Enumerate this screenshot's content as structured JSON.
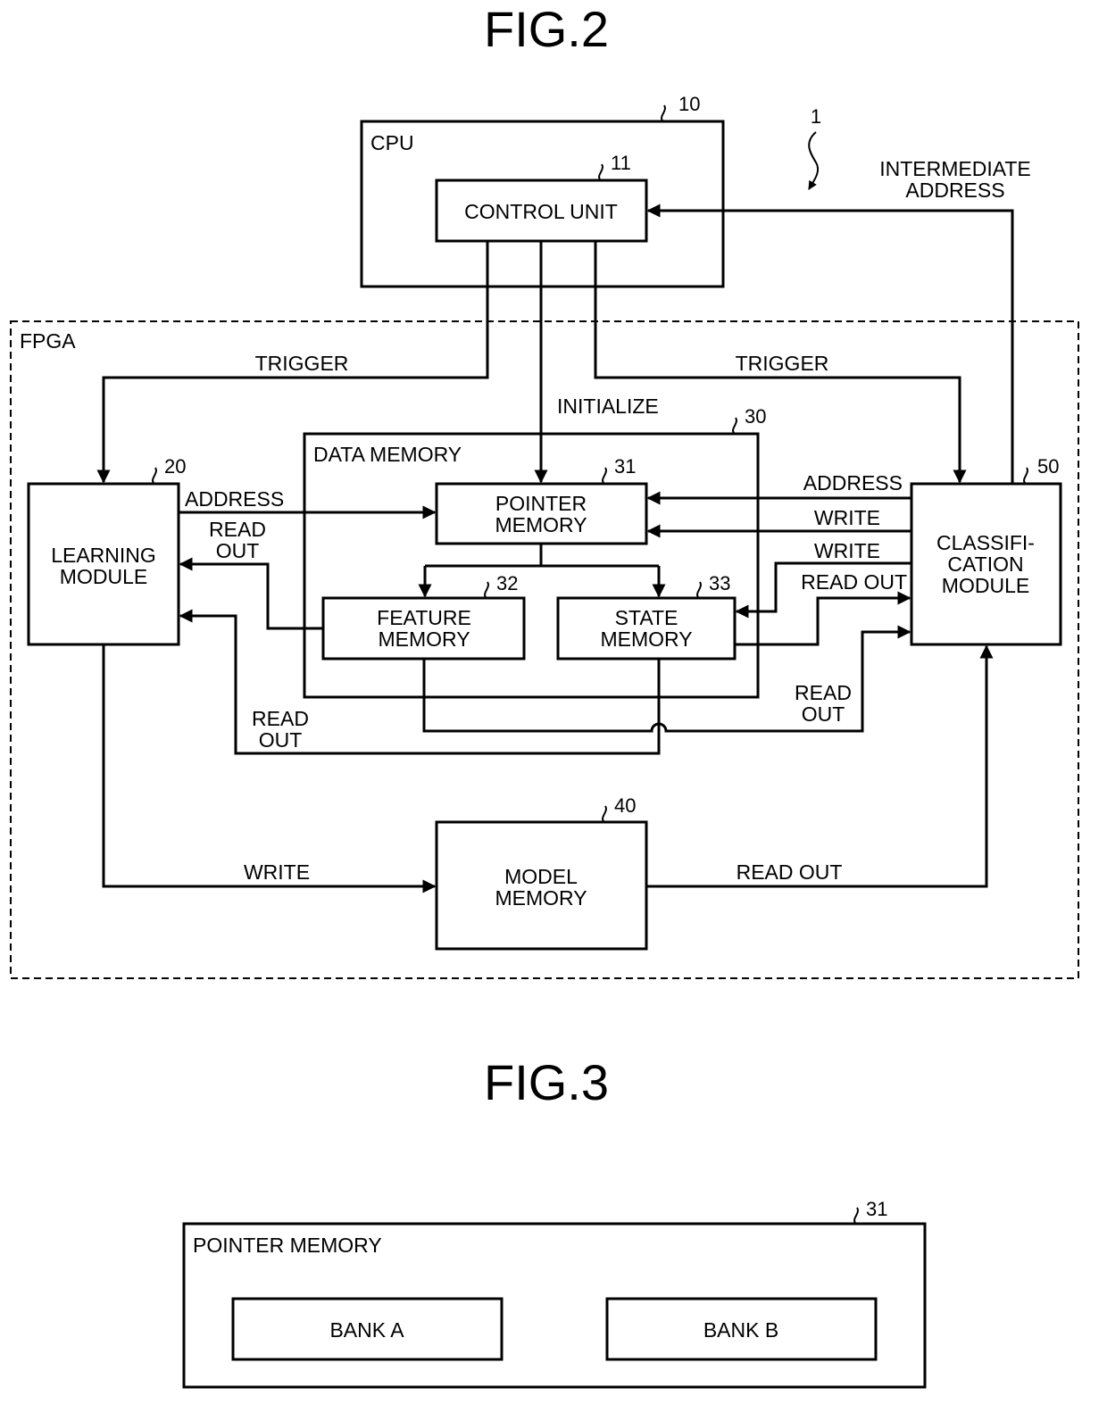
{
  "fig2": {
    "title": "FIG.2",
    "system_ref": "1",
    "cpu": {
      "label": "CPU",
      "ref": "10"
    },
    "control_unit": {
      "label": "CONTROL UNIT",
      "ref": "11"
    },
    "fpga": {
      "label": "FPGA"
    },
    "learning_module": {
      "line1": "LEARNING",
      "line2": "MODULE",
      "ref": "20"
    },
    "data_memory": {
      "label": "DATA MEMORY",
      "ref": "30"
    },
    "pointer_memory": {
      "line1": "POINTER",
      "line2": "MEMORY",
      "ref": "31"
    },
    "feature_memory": {
      "line1": "FEATURE",
      "line2": "MEMORY",
      "ref": "32"
    },
    "state_memory": {
      "line1": "STATE",
      "line2": "MEMORY",
      "ref": "33"
    },
    "model_memory": {
      "line1": "MODEL",
      "line2": "MEMORY",
      "ref": "40"
    },
    "classification_module": {
      "line1": "CLASSIFI-",
      "line2": "CATION",
      "line3": "MODULE",
      "ref": "50"
    },
    "signals": {
      "trigger_left": "TRIGGER",
      "trigger_right": "TRIGGER",
      "initialize": "INITIALIZE",
      "intermediate_address_1": "INTERMEDIATE",
      "intermediate_address_2": "ADDRESS",
      "learning_address": "ADDRESS",
      "learning_read_out_1": "READ",
      "learning_read_out_2": "OUT",
      "bottom_read_out_left_1": "READ",
      "bottom_read_out_left_2": "OUT",
      "bottom_read_out_right_1": "READ",
      "bottom_read_out_right_2": "OUT",
      "class_address": "ADDRESS",
      "class_write_1": "WRITE",
      "class_write_2": "WRITE",
      "class_read_out": "READ OUT",
      "model_write": "WRITE",
      "model_read_out": "READ OUT"
    }
  },
  "fig3": {
    "title": "FIG.3",
    "pointer_memory": {
      "label": "POINTER MEMORY",
      "ref": "31"
    },
    "bank_a": "BANK A",
    "bank_b": "BANK B"
  }
}
